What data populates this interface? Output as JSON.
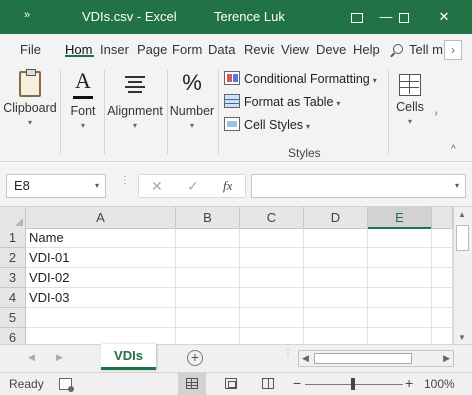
{
  "titlebar": {
    "quick_access": "»",
    "title": "VDIs.csv  -  Excel",
    "user": "Terence Luk",
    "minimize": "—",
    "close": "✕"
  },
  "ribbon_tabs": [
    "File",
    "Hom",
    "Inser",
    "Page",
    "Form",
    "Data",
    "Revie",
    "View",
    "Deve",
    "Help"
  ],
  "active_tab": "Hom",
  "tell_me": "Tell m",
  "tab_scroll": "›",
  "ribbon": {
    "clipboard": "Clipboard",
    "font": "Font",
    "font_icon": "A",
    "alignment": "Alignment",
    "number": "Number",
    "number_icon": "%",
    "conditional_formatting": "Conditional Formatting",
    "format_as_table": "Format as Table",
    "cell_styles": "Cell Styles",
    "styles_group": "Styles",
    "cells": "Cells",
    "caret": "▾",
    "more": "›",
    "collapse": "^"
  },
  "formula_bar": {
    "name_box": "E8",
    "dots": "⋮",
    "cancel": "✕",
    "enter": "✓",
    "fx": "fx",
    "formula": "",
    "caret": "▾"
  },
  "sheet": {
    "columns": [
      "A",
      "B",
      "C",
      "D",
      "E"
    ],
    "selected_column": "E",
    "rows": [
      {
        "num": "1",
        "a": "Name"
      },
      {
        "num": "2",
        "a": "VDI-01"
      },
      {
        "num": "3",
        "a": "VDI-02"
      },
      {
        "num": "4",
        "a": "VDI-03"
      },
      {
        "num": "5",
        "a": ""
      },
      {
        "num": "6",
        "a": ""
      }
    ]
  },
  "sheet_tabs": {
    "prev": "◀",
    "next": "▶",
    "active": "VDIs",
    "add": "+",
    "dots": "⋮",
    "scroll_left": "◀",
    "scroll_right": "▶",
    "up": "▲",
    "down": "▼"
  },
  "status": {
    "ready": "Ready",
    "zoom_minus": "−",
    "zoom_plus": "+",
    "zoom_level": "100%"
  },
  "colors": {
    "accent": "#217346"
  }
}
